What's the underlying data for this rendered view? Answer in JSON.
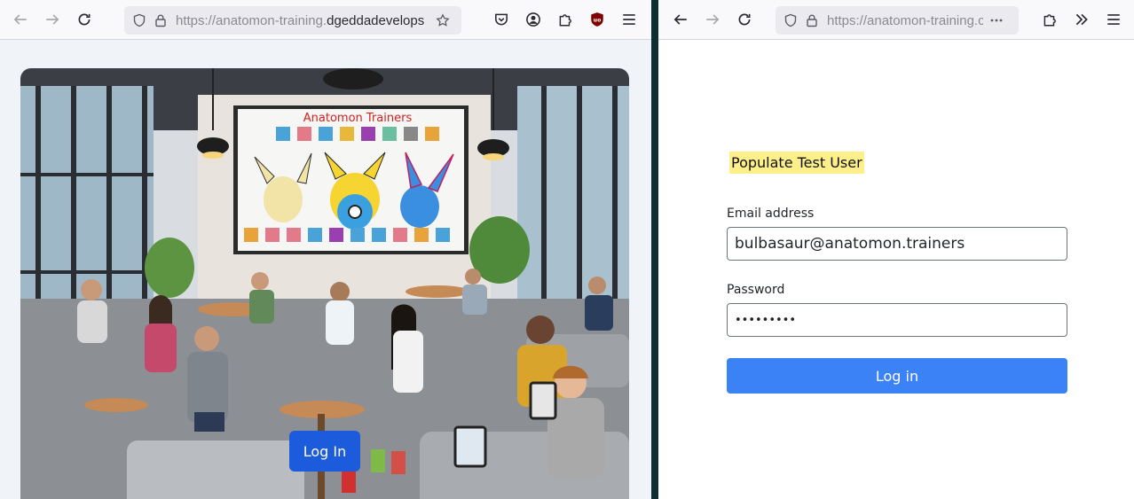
{
  "left_window": {
    "url_prefix": "https://anatomon-training.",
    "url_domain": "dgeddadevelops",
    "hero": {
      "poster_title": "Anatomon Trainers",
      "login_button": "Log In"
    }
  },
  "right_window": {
    "url": "https://anatomon-training.c",
    "populate_label": "Populate Test User",
    "email_label": "Email address",
    "email_value": "bulbasaur@anatomon.trainers",
    "password_label": "Password",
    "password_value": "•••••••••",
    "login_button": "Log in"
  },
  "colors": {
    "hero_button": "#1c5cdc",
    "login_button": "#3b82f6",
    "populate_highlight": "#fdf08a",
    "divider": "#0e2e2f"
  },
  "icons": {
    "back": "back-arrow-icon",
    "forward": "forward-arrow-icon",
    "reload": "reload-icon",
    "shield": "shield-icon",
    "lock": "lock-icon",
    "star": "star-icon",
    "pocket": "pocket-icon",
    "account": "account-icon",
    "extensions": "puzzle-icon",
    "ublock": "ublock-icon",
    "menu": "hamburger-menu-icon",
    "overflow": "chevrons-right-icon",
    "more": "more-dots-icon"
  }
}
